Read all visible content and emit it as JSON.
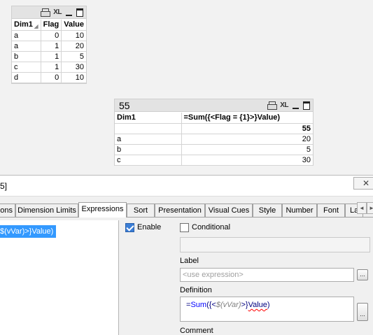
{
  "table1": {
    "caption_icons": {
      "print": "printer-icon",
      "xl": "XL",
      "min": "minimize-icon",
      "max": "maximize-icon"
    },
    "headers": [
      "Dim1",
      "Flag",
      "Value"
    ],
    "sort_icon": "sort-indicator-icon",
    "rows": [
      [
        "a",
        "0",
        "10"
      ],
      [
        "a",
        "1",
        "20"
      ],
      [
        "b",
        "1",
        "5"
      ],
      [
        "c",
        "1",
        "30"
      ],
      [
        "d",
        "0",
        "10"
      ]
    ]
  },
  "chart": {
    "title": "55",
    "caption_icons": {
      "print": "printer-icon",
      "xl": "XL",
      "min": "minimize-icon",
      "max": "maximize-icon"
    },
    "headers": [
      "Dim1",
      "=Sum({<Flag = {1}>}Value)"
    ],
    "total": "55",
    "rows": [
      [
        "a",
        "20"
      ],
      [
        "b",
        "5"
      ],
      [
        "c",
        "30"
      ]
    ]
  },
  "dialog": {
    "title": "5]",
    "close_icon": "close-icon",
    "tabs": [
      "ons",
      "Dimension Limits",
      "Expressions",
      "Sort",
      "Presentation",
      "Visual Cues",
      "Style",
      "Number",
      "Font",
      "La"
    ],
    "active_tab": "Expressions",
    "scroll_left": "◄",
    "scroll_right": "►",
    "expression_item": "$(vVar)>}Value)",
    "enable_label": "Enable",
    "conditional_label": "Conditional",
    "label_caption": "Label",
    "label_placeholder": "<use expression>",
    "definition_caption": "Definition",
    "definition": {
      "part1": "=",
      "part2": "Sum",
      "part3": "({<",
      "part4": "$(vVar)",
      "part5": ">}",
      "part6": "Value",
      "part7": ")"
    },
    "comment_caption": "Comment",
    "dots": "..."
  },
  "colors": {
    "selection": "#3399ff",
    "caption_bg": "#e3e3e3",
    "dialog_bg": "#f0f0f0"
  }
}
